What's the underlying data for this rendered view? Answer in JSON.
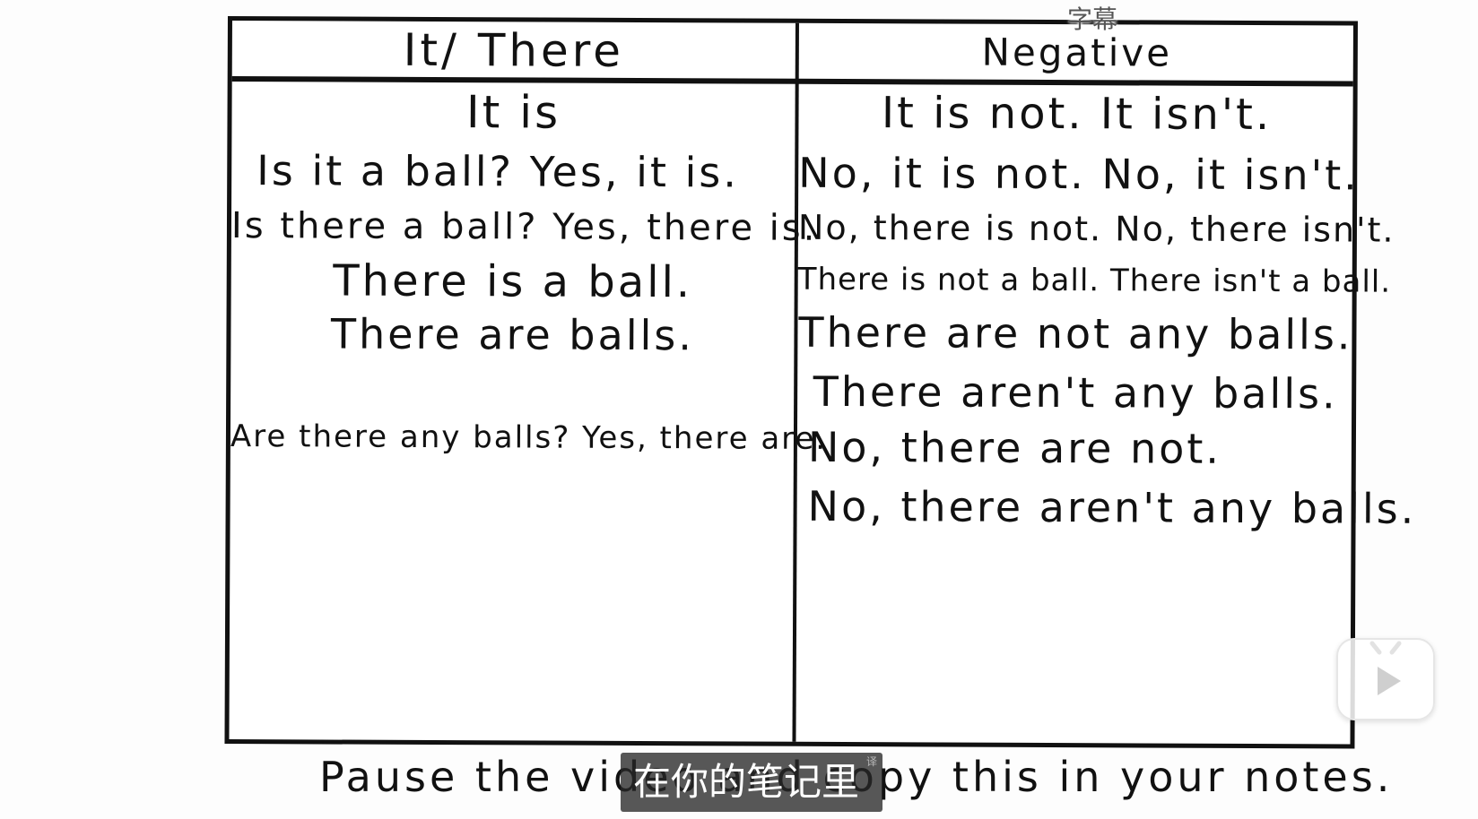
{
  "table": {
    "left_header": "It/ There",
    "right_header": "Negative",
    "left_lines": [
      "It is",
      "Is it a ball?   Yes, it is.",
      "Is there a ball? Yes, there is.",
      "There is a ball.",
      "There are balls.",
      "Are there any balls? Yes, there are."
    ],
    "right_lines": [
      "It is not. It isn't.",
      "No, it is not. No, it isn't.",
      "No, there is not. No, there isn't.",
      "There is not a ball. There isn't a ball.",
      "There are not any balls.",
      "There aren't any balls.",
      "No, there are not.",
      "No, there aren't any balls."
    ]
  },
  "caption": "Pause the video and copy this in your notes.",
  "player": {
    "subtitle_toggle_label": "字幕",
    "subtitle_text": "在你的笔记里",
    "subtitle_tiny": "译",
    "play_icon": "play-icon"
  }
}
